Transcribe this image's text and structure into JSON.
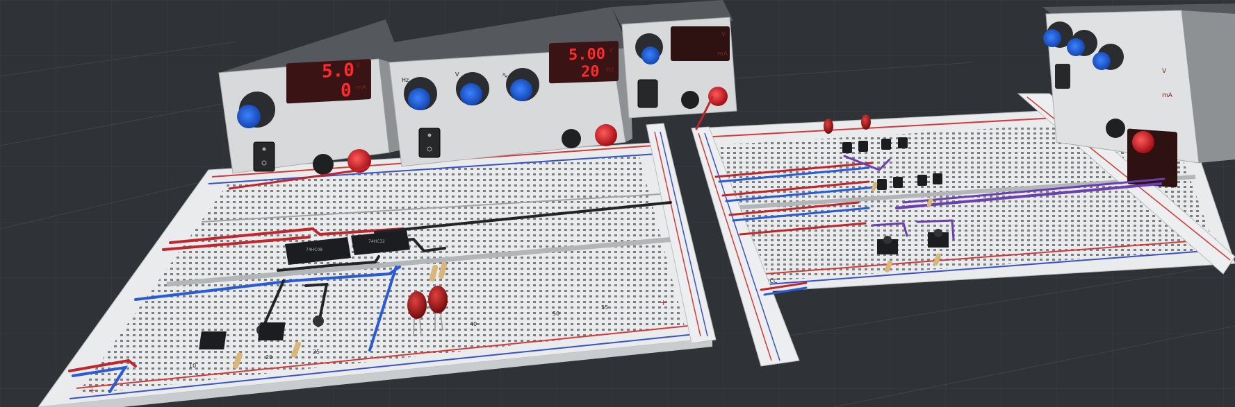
{
  "supply1": {
    "voltage": "5.0",
    "current": "0",
    "v_unit": "V",
    "i_unit": "mA"
  },
  "generator": {
    "voltage": "5.00",
    "frequency": "20",
    "v_unit": "V",
    "f_unit": "Hz",
    "knob_labels": [
      "Hz",
      "V"
    ]
  },
  "supply3": {
    "v_unit": "V",
    "i_unit": "mA"
  },
  "supply4": {
    "v_unit": "V",
    "i_unit": "mA"
  },
  "breadboard_left": {
    "row_labels": [
      "10",
      "20",
      "25",
      "40",
      "50",
      "55"
    ],
    "rail_plus": "+",
    "rail_minus": "-"
  },
  "breadboard_right": {
    "vcc_label": "VCC",
    "rail_plus": "+",
    "rail_minus": "-"
  },
  "colors": {
    "wire_red": "#c0262b",
    "wire_black": "#222428",
    "wire_blue": "#2a5bd6",
    "wire_purple": "#6a3fb0",
    "knob_blue": "#1f5fd8",
    "led_red": "#b51818",
    "display_red": "#ff2a2a"
  }
}
